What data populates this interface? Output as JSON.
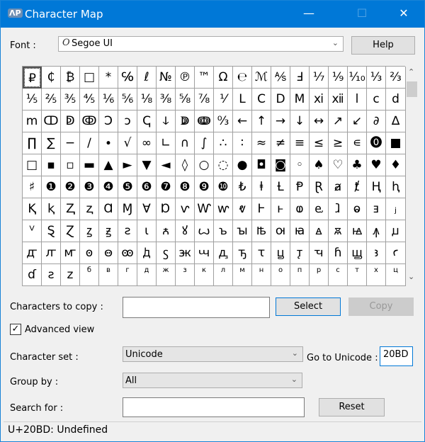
{
  "window": {
    "title": "Character Map",
    "app_icon": "ΛΡ",
    "minimize": "—",
    "maximize": "☐",
    "close": "✕",
    "accent": "#0078d7"
  },
  "font": {
    "label": "Font :",
    "value": "Segoe UI",
    "font_icon": "O",
    "help": "Help"
  },
  "grid": {
    "selected_index": 0,
    "rows": [
      [
        "₽",
        "₵",
        "₿",
        "□",
        "*",
        "℅",
        "ℓ",
        "№",
        "℗",
        "™",
        "Ω",
        "℮",
        "ℳ",
        "⅍",
        "Ⅎ",
        "⅐",
        "⅑",
        "⅒",
        "⅓",
        "⅔"
      ],
      [
        "⅕",
        "⅖",
        "⅗",
        "⅘",
        "⅙",
        "⅚",
        "⅛",
        "⅜",
        "⅝",
        "⅞",
        "⅟",
        "Ⅼ",
        "Ⅽ",
        "Ⅾ",
        "Ⅿ",
        "ⅺ",
        "ⅻ",
        "ⅼ",
        "ⅽ",
        "ⅾ"
      ],
      [
        "ⅿ",
        "ↀ",
        "ↁ",
        "ↂ",
        "Ↄ",
        "ↄ",
        "ↅ",
        "ↆ",
        "ↇ",
        "ↈ",
        "↉",
        "←",
        "↑",
        "→",
        "↓",
        "↔",
        "↗",
        "↙",
        "∂",
        "∆"
      ],
      [
        "∏",
        "∑",
        "−",
        "∕",
        "∙",
        "√",
        "∞",
        "∟",
        "∩",
        "∫",
        "∴",
        "∶",
        "≈",
        "≠",
        "≡",
        "≤",
        "≥",
        "∊",
        "⓿",
        "■"
      ],
      [
        "□",
        "▪",
        "▫",
        "▬",
        "▲",
        "►",
        "▼",
        "◄",
        "◊",
        "○",
        "◌",
        "●",
        "◘",
        "◙",
        "◦",
        "♠",
        "♡",
        "♣",
        "♥",
        "♦"
      ],
      [
        "♯",
        "❶",
        "❷",
        "❸",
        "❹",
        "❺",
        "❻",
        "❼",
        "❽",
        "❾",
        "❿",
        "₺",
        "ⱡ",
        "Ƚ",
        "Ᵽ",
        "Ɽ",
        "ⱥ",
        "ⱦ",
        "Ⱨ",
        "ⱨ"
      ],
      [
        "Ⱪ",
        "ⱪ",
        "Ⱬ",
        "ⱬ",
        "Ɑ",
        "Ɱ",
        "Ɐ",
        "Ɒ",
        "ⱱ",
        "Ⱳ",
        "ⱳ",
        "ⱴ",
        "Ⱶ",
        "ⱶ",
        "ⱷ",
        "ⱸ",
        "ⱹ",
        "ⱺ",
        "ⱻ",
        "ⱼ"
      ],
      [
        "ⱽ",
        "Ȿ",
        "Ɀ",
        "ꙁ",
        "ꙃ",
        "ꙅ",
        "ꙇ",
        "ꙉ",
        "ꙋ",
        "ꙍ",
        "ꙏ",
        "ꙑ",
        "ꙓ",
        "ꙕ",
        "ꙗ",
        "ꙙ",
        "ꙛ",
        "ꙝ",
        "ꙟ",
        "ꙡ"
      ],
      [
        "ꙣ",
        "ꙥ",
        "ꙧ",
        "ꙩ",
        "ꙫ",
        "ꙭ",
        "ꚁ",
        "ꚃ",
        "ꚅ",
        "ꚇ",
        "ꚉ",
        "ꚋ",
        "ꚍ",
        "ꚏ",
        "ꚑ",
        "ꚓ",
        "ꚕ",
        "ꚗ",
        "ꜣ",
        "ꜥ"
      ],
      [
        "ɗ",
        "ƨ",
        "z",
        "б",
        "в",
        "г",
        "д",
        "ж",
        "з",
        "к",
        "л",
        "м",
        "н",
        "о",
        "п",
        "р",
        "с",
        "т",
        "х",
        "ц"
      ]
    ]
  },
  "copy": {
    "label": "Characters to copy :",
    "value": "",
    "select": "Select",
    "copy": "Copy"
  },
  "advanced": {
    "label": "Advanced view",
    "checked": true
  },
  "charset": {
    "label": "Character set :",
    "value": "Unicode",
    "goto_label": "Go to Unicode :",
    "goto_value": "20BD"
  },
  "groupby": {
    "label": "Group by :",
    "value": "All"
  },
  "search": {
    "label": "Search for :",
    "value": "",
    "reset": "Reset"
  },
  "status": "U+20BD: Undefined"
}
